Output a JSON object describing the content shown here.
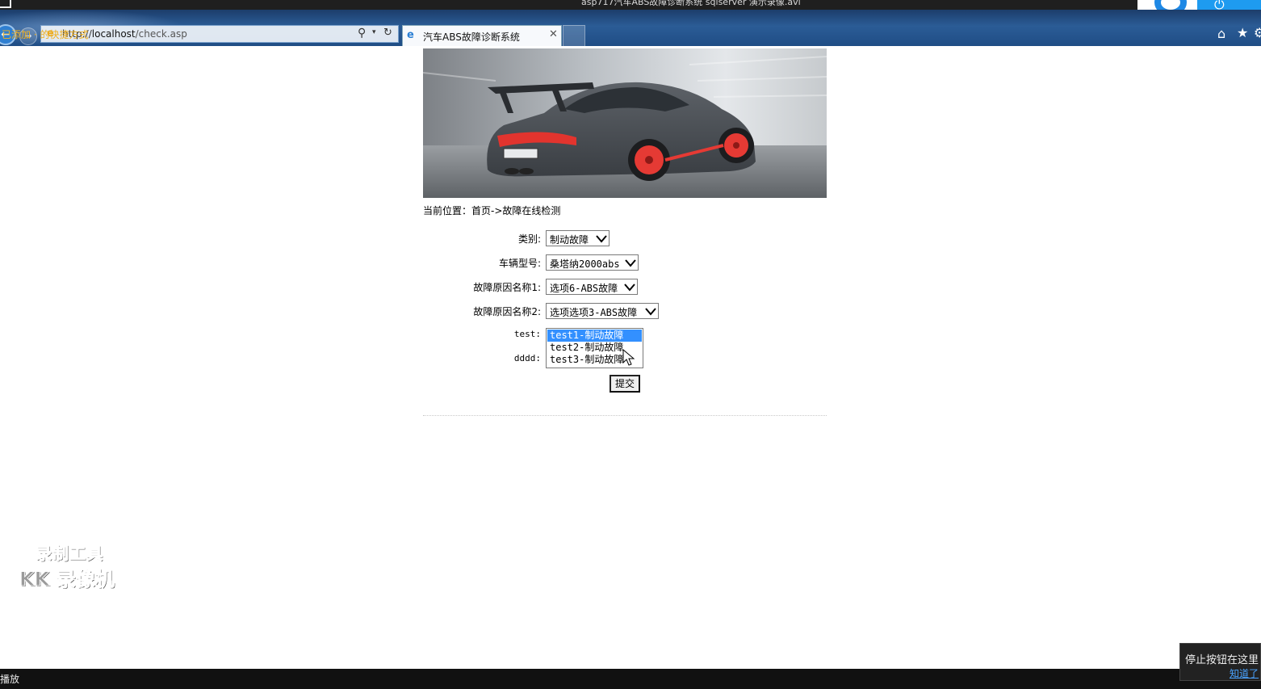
{
  "window": {
    "title": "asp717汽车ABS故障诊断系统 sqlserver 演示录像.avi"
  },
  "browser": {
    "address": {
      "prefix": "http://",
      "host": "localhost",
      "path": "/check.asp"
    },
    "overlay_text": "已添加 · 的快捷方式",
    "tab": {
      "title": "汽车ABS故障诊断系统"
    }
  },
  "page": {
    "breadcrumb": "当前位置：首页->故障在线检测",
    "form": {
      "category": {
        "label": "类别:",
        "value": "制动故障"
      },
      "vehicle_model": {
        "label": "车辆型号:",
        "value": "桑塔纳2000abs"
      },
      "fault_cause_1": {
        "label": "故障原因名称1:",
        "value": "选项6-ABS故障"
      },
      "fault_cause_2": {
        "label": "故障原因名称2:",
        "value": "选项选项3-ABS故障"
      },
      "test": {
        "label": "test:",
        "options": [
          {
            "text": "test1-制动故障",
            "selected": true
          },
          {
            "text": "test2-制动故障",
            "selected": false
          },
          {
            "text": "test3-制动故障",
            "selected": false
          }
        ]
      },
      "dddd": {
        "label": "dddd:"
      },
      "submit_label": "提交"
    }
  },
  "watermark": {
    "line1": "录制工具",
    "line2": "KK 录像机"
  },
  "player": {
    "status": "播放",
    "tip": {
      "text": "停止按钮在这里",
      "link": "知道了"
    }
  },
  "colors": {
    "accent": "#1e9bf0",
    "selection": "#3390ff",
    "chrome": "#2b5c96"
  }
}
